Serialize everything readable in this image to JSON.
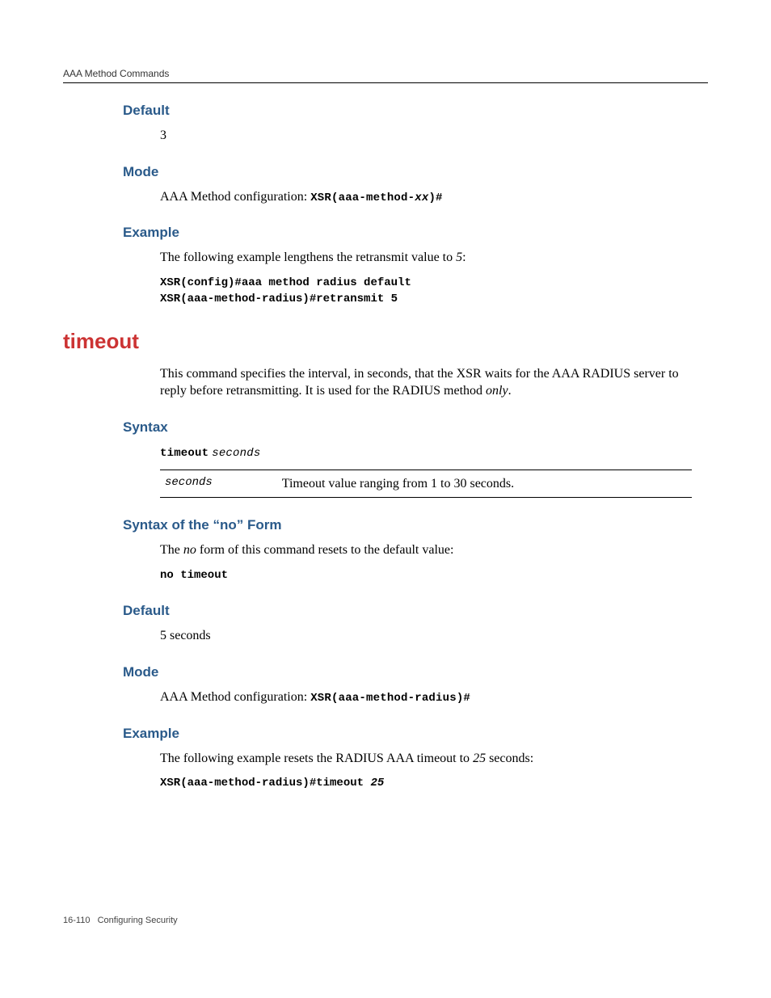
{
  "running_head": "AAA Method Commands",
  "retransmit": {
    "default_h": "Default",
    "default_val": "3",
    "mode_h": "Mode",
    "mode_prefix": "AAA Method configuration: ",
    "mode_prompt_a": "XSR(aaa-method-",
    "mode_prompt_var": "xx",
    "mode_prompt_b": ")#",
    "example_h": "Example",
    "example_text_a": "The following example lengthens the retransmit value to ",
    "example_text_val": "5",
    "example_text_b": ":",
    "example_code": "XSR(config)#aaa method radius default\nXSR(aaa-method-radius)#retransmit 5"
  },
  "timeout": {
    "title": "timeout",
    "desc_a": "This command specifies the interval, in seconds, that the XSR waits for the AAA RADIUS server to reply before retransmitting. It is used for the RADIUS method ",
    "desc_only": "only",
    "desc_b": ".",
    "syntax_h": "Syntax",
    "syntax_cmd": "timeout",
    "syntax_arg": "seconds",
    "table_param": "seconds",
    "table_desc": "Timeout value ranging from 1 to 30 seconds.",
    "no_h": "Syntax of the “no” Form",
    "no_text_a": "The ",
    "no_text_ital": "no",
    "no_text_b": " form of this command resets to the default value:",
    "no_code": "no timeout",
    "default_h": "Default",
    "default_val": "5 seconds",
    "mode_h": "Mode",
    "mode_prefix": "AAA Method configuration: ",
    "mode_prompt": "XSR(aaa-method-radius)#",
    "example_h": "Example",
    "example_text_a": "The following example resets the RADIUS AAA timeout to ",
    "example_text_val": "25",
    "example_text_b": " seconds:",
    "example_code_a": "XSR(aaa-method-radius)#timeout ",
    "example_code_arg": "25"
  },
  "footer": {
    "page": "16-110",
    "title": "Configuring Security"
  }
}
